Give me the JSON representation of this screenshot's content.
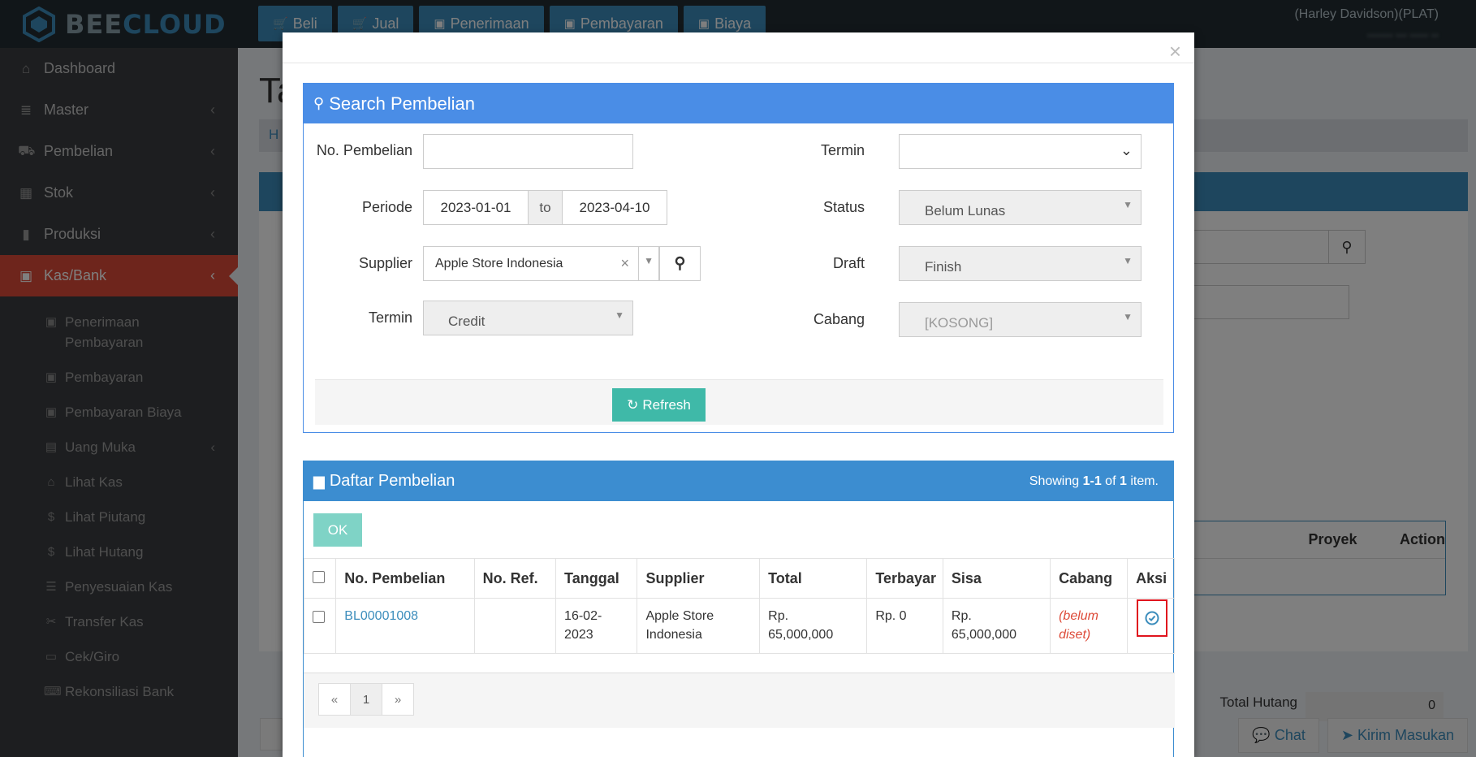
{
  "header": {
    "logo_bee": "BEE",
    "logo_cloud": "CLOUD",
    "nav": [
      {
        "label": "Beli",
        "icon": "cart-icon"
      },
      {
        "label": "Jual",
        "icon": "cart-icon"
      },
      {
        "label": "Penerimaan",
        "icon": "money-icon"
      },
      {
        "label": "Pembayaran",
        "icon": "money-icon"
      },
      {
        "label": "Biaya",
        "icon": "money-icon"
      }
    ],
    "user": "(Harley Davidson)(PLAT)",
    "user_sub": "blurred-user-info"
  },
  "sidebar": {
    "items": [
      {
        "label": "Dashboard"
      },
      {
        "label": "Master"
      },
      {
        "label": "Pembelian"
      },
      {
        "label": "Stok"
      },
      {
        "label": "Produksi"
      },
      {
        "label": "Kas/Bank"
      }
    ],
    "sub": [
      {
        "label": "Penerimaan Pembayaran"
      },
      {
        "label": "Pembayaran"
      },
      {
        "label": "Pembayaran Biaya"
      },
      {
        "label": "Uang Muka"
      },
      {
        "label": "Lihat Kas"
      },
      {
        "label": "Lihat Piutang"
      },
      {
        "label": "Lihat Hutang"
      },
      {
        "label": "Penyesuaian Kas"
      },
      {
        "label": "Transfer Kas"
      },
      {
        "label": "Cek/Giro"
      },
      {
        "label": "Rekonsiliasi Bank"
      }
    ]
  },
  "background": {
    "title": "Ta",
    "crumb": "H",
    "table_headers": [
      "Proyek",
      "Action"
    ],
    "total_label": "Total Hutang",
    "total_value": "0",
    "chat": "Chat",
    "kirim": "Kirim Masukan"
  },
  "modal": {
    "close": "×",
    "search": {
      "title": "Search Pembelian",
      "no_pembelian_label": "No. Pembelian",
      "no_pembelian_value": "",
      "periode_label": "Periode",
      "date_from": "2023-01-01",
      "date_to_sep": "to",
      "date_to": "2023-04-10",
      "supplier_label": "Supplier",
      "supplier_value": "Apple Store Indonesia",
      "termin_label": "Termin",
      "termin_value": "Credit",
      "termin2_label": "Termin",
      "termin2_value": "",
      "status_label": "Status",
      "status_value": "Belum Lunas",
      "draft_label": "Draft",
      "draft_value": "Finish",
      "cabang_label": "Cabang",
      "cabang_value": "[KOSONG]",
      "refresh": "Refresh"
    },
    "list": {
      "title": "Daftar Pembelian",
      "showing_prefix": "Showing ",
      "showing_range": "1-1",
      "showing_of": " of ",
      "showing_total": "1",
      "showing_suffix": " item.",
      "ok": "OK",
      "columns": [
        "No. Pembelian",
        "No. Ref.",
        "Tanggal",
        "Supplier",
        "Total",
        "Terbayar",
        "Sisa",
        "Cabang",
        "Aksi"
      ],
      "rows": [
        {
          "no": "BL00001008",
          "ref": "",
          "tanggal": "16-02-2023",
          "supplier": "Apple Store Indonesia",
          "total": "Rp. 65,000,000",
          "terbayar": "Rp. 0",
          "sisa": "Rp. 65,000,000",
          "cabang": "(belum diset)"
        }
      ],
      "pager": {
        "prev": "«",
        "page": "1",
        "next": "»"
      }
    }
  }
}
